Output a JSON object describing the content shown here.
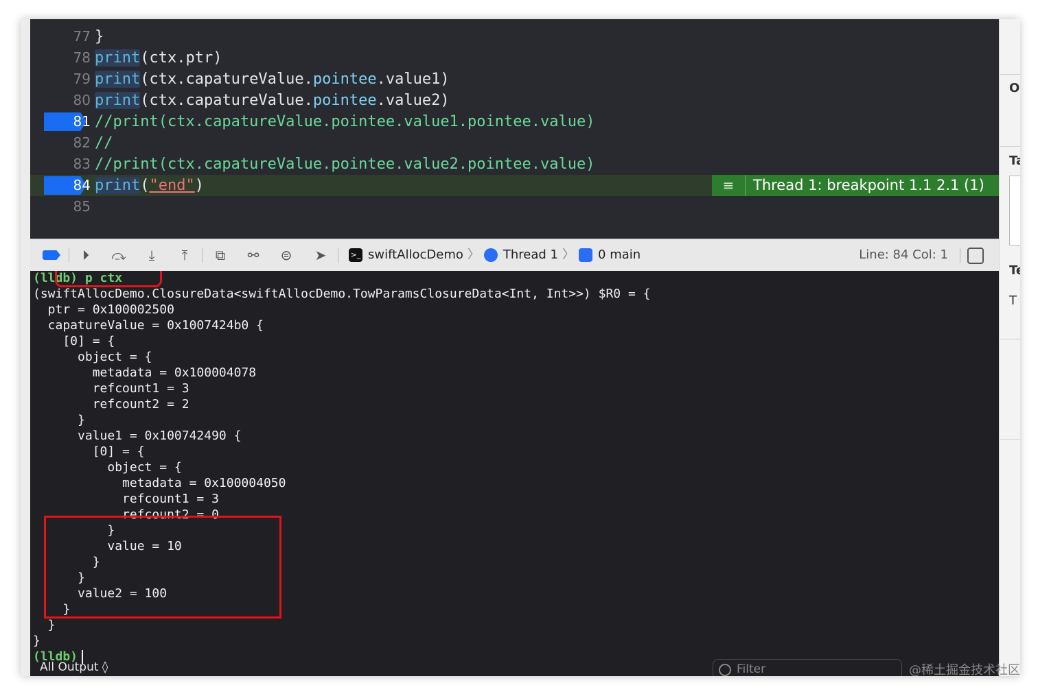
{
  "editor": {
    "lines": [
      {
        "num": "77",
        "code": "}"
      },
      {
        "num": "78",
        "fn": "print",
        "rest": "(ctx.ptr)"
      },
      {
        "num": "79",
        "fn": "print",
        "a": "(ctx.capatureValue.",
        "b": "pointee",
        "c": ".value1)"
      },
      {
        "num": "80",
        "fn": "print",
        "a": "(ctx.capatureValue.",
        "b": "pointee",
        "c": ".value2)"
      },
      {
        "num": "81",
        "comment": "//print(ctx.capatureValue.pointee.value1.pointee.value)"
      },
      {
        "num": "82",
        "comment": "//"
      },
      {
        "num": "83",
        "comment": "//print(ctx.capatureValue.pointee.value2.pointee.value)"
      },
      {
        "num": "84",
        "fn": "print",
        "open": "(",
        "str": "\"end\"",
        "close": ")"
      },
      {
        "num": "85"
      }
    ],
    "thread_badge": "Thread 1: breakpoint 1.1 2.1 (1)"
  },
  "toolbar": {
    "app": "swiftAllocDemo",
    "thread": "Thread 1",
    "frame": "0 main",
    "line_col": "Line: 84  Col: 1"
  },
  "console": {
    "lines": [
      "(lldb) p ctx",
      "(swiftAllocDemo.ClosureData<swiftAllocDemo.TowParamsClosureData<Int, Int>>) $R0 = {",
      "  ptr = 0x100002500",
      "  capatureValue = 0x1007424b0 {",
      "    [0] = {",
      "      object = {",
      "        metadata = 0x100004078",
      "        refcount1 = 3",
      "        refcount2 = 2",
      "      }",
      "      value1 = 0x100742490 {",
      "        [0] = {",
      "          object = {",
      "            metadata = 0x100004050",
      "            refcount1 = 3",
      "            refcount2 = 0",
      "          }",
      "          value = 10",
      "        }",
      "      }",
      "      value2 = 100",
      "    }",
      "  }",
      "}"
    ],
    "prompt": "(lldb)",
    "output_selector": "All Output ◊",
    "filter_placeholder": "Filter"
  },
  "inspector": {
    "t1": "O",
    "t2": "Ta",
    "t3": "Te",
    "t4": "T"
  },
  "watermark": "@稀土掘金技术社区",
  "colors": {
    "breakpoint": "#1a6cf2",
    "thread_badge": "#2e7d2e",
    "annotation": "#e0141b",
    "prompt": "#6fcf6f"
  }
}
